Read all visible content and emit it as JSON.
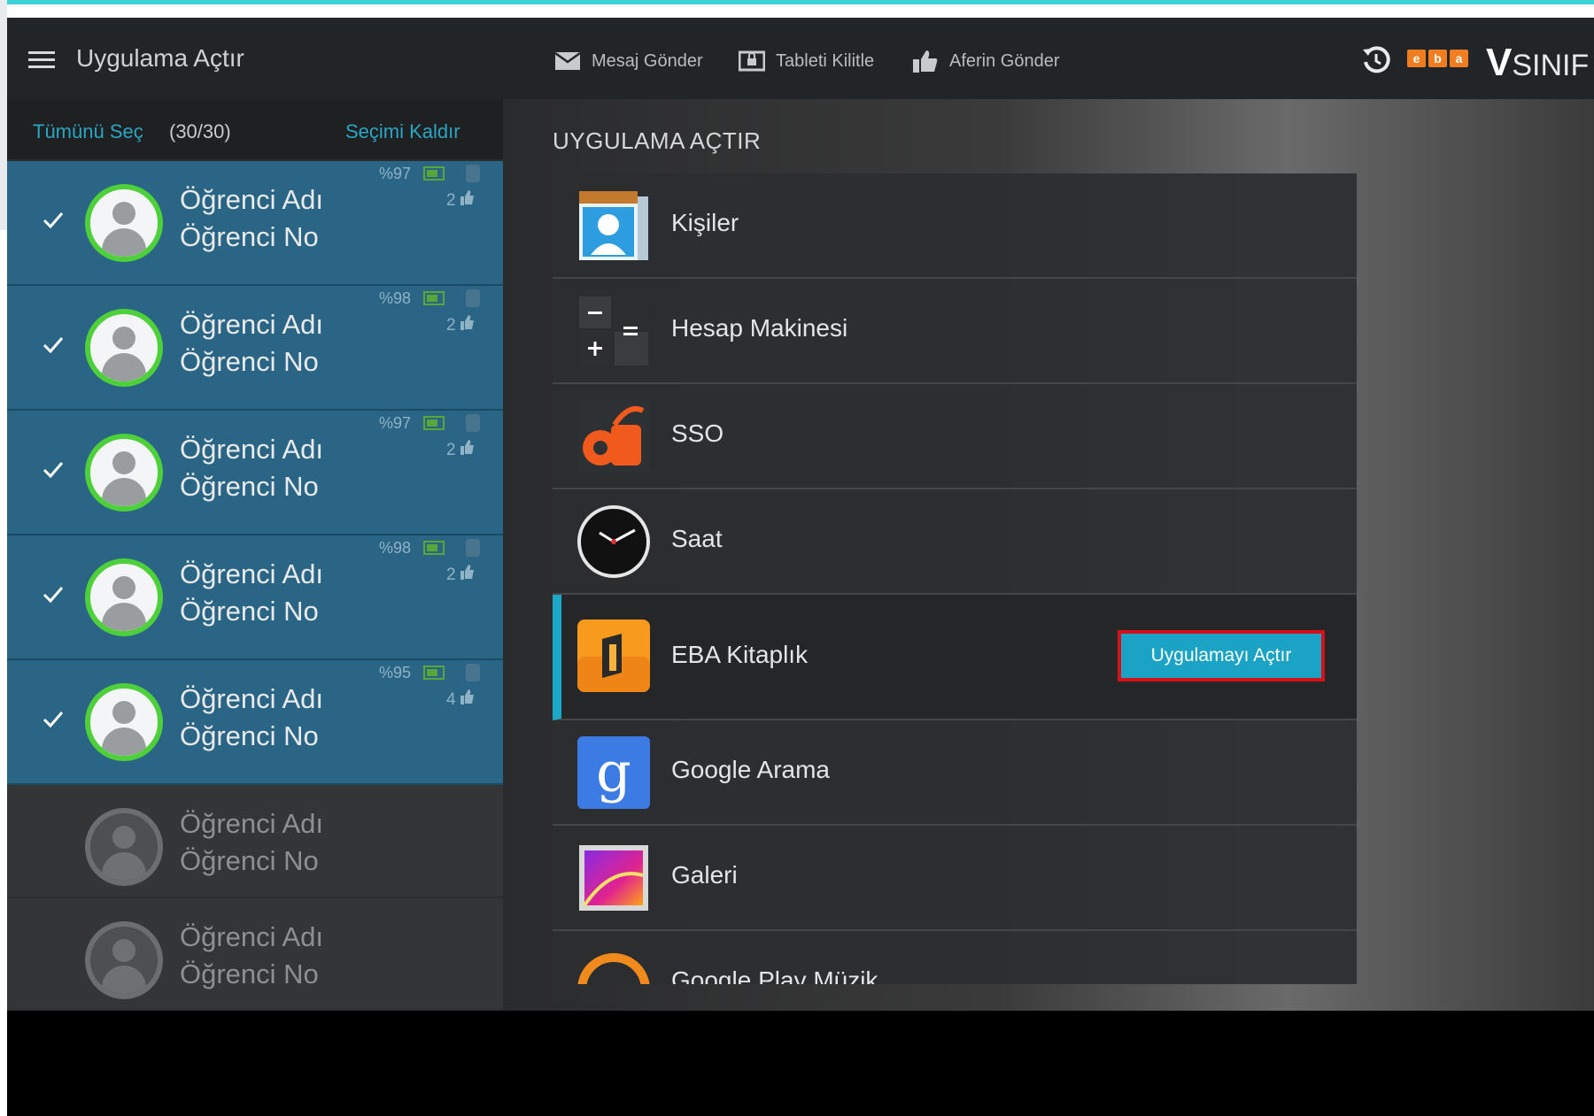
{
  "topbar": {
    "title": "Uygulama Açtır",
    "actions": [
      {
        "label": "Mesaj Gönder",
        "icon": "envelope-icon"
      },
      {
        "label": "Tableti Kilitle",
        "icon": "tablet-lock-icon"
      },
      {
        "label": "Aferin Gönder",
        "icon": "thumbs-up-icon"
      }
    ],
    "brand_logo": "eba",
    "brand_v": "V",
    "brand_text": "SINIF"
  },
  "selection": {
    "select_all": "Tümünü Seç",
    "count": "(30/30)",
    "clear": "Seçimi Kaldır"
  },
  "students": [
    {
      "name": "Öğrenci Adı",
      "number": "Öğrenci No",
      "battery": "%97",
      "praise": "2",
      "selected": true
    },
    {
      "name": "Öğrenci Adı",
      "number": "Öğrenci No",
      "battery": "%98",
      "praise": "2",
      "selected": true
    },
    {
      "name": "Öğrenci Adı",
      "number": "Öğrenci No",
      "battery": "%97",
      "praise": "2",
      "selected": true
    },
    {
      "name": "Öğrenci Adı",
      "number": "Öğrenci No",
      "battery": "%98",
      "praise": "2",
      "selected": true
    },
    {
      "name": "Öğrenci Adı",
      "number": "Öğrenci No",
      "battery": "%95",
      "praise": "4",
      "selected": true
    },
    {
      "name": "Öğrenci Adı",
      "number": "Öğrenci No",
      "selected": false
    },
    {
      "name": "Öğrenci Adı",
      "number": "Öğrenci No",
      "selected": false
    }
  ],
  "main": {
    "section_title": "UYGULAMA AÇTIR",
    "apps": [
      {
        "label": "Kişiler",
        "icon": "contacts-icon"
      },
      {
        "label": "Hesap Makinesi",
        "icon": "calculator-icon"
      },
      {
        "label": "SSO",
        "icon": "sso-icon"
      },
      {
        "label": "Saat",
        "icon": "clock-icon"
      },
      {
        "label": "EBA Kitaplık",
        "icon": "eba-library-icon",
        "active": true
      },
      {
        "label": "Google Arama",
        "icon": "google-search-icon"
      },
      {
        "label": "Galeri",
        "icon": "gallery-icon"
      },
      {
        "label": "Google Play Müzik",
        "icon": "play-music-icon"
      }
    ],
    "launch_button": "Uygulamayı Açtır"
  },
  "colors": {
    "accent": "#1ba7c7",
    "selected_row": "#2a6586",
    "avatar_ring": "#4ed03a",
    "highlight_border": "#d8101a",
    "brand_orange": "#f07d1f"
  }
}
